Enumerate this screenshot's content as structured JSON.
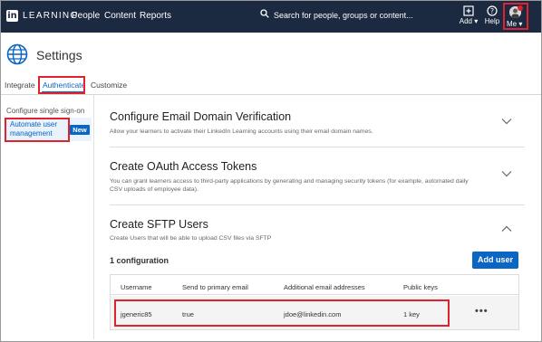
{
  "nav": {
    "logo": "in",
    "brand": "LEARNING",
    "links": [
      "People",
      "Content",
      "Reports"
    ],
    "search_placeholder": "Search for people, groups or content...",
    "add_label": "Add ▾",
    "help_label": "Help",
    "me_label": "Me ▾"
  },
  "page": {
    "title": "Settings"
  },
  "tabs": [
    "Integrate",
    "Authenticate",
    "Customize"
  ],
  "sidebar": {
    "section_title": "Configure single sign-on",
    "item_label": "Automate user management",
    "item_badge": "New"
  },
  "sections": [
    {
      "title": "Configure Email Domain Verification",
      "description": "Allow your learners to activate their LinkedIn Learning accounts using their email domain names."
    },
    {
      "title": "Create OAuth Access Tokens",
      "description": "You can grant learners access to third-party applications by generating and managing security tokens (for example, automated daily CSV uploads of employee data)."
    },
    {
      "title": "Create SFTP Users",
      "description": "Create Users that will be able to upload CSV files via SFTP"
    }
  ],
  "sftp": {
    "config_count": "1 configuration",
    "add_user_label": "Add user",
    "columns": [
      "Username",
      "Send to primary email",
      "Additional email addresses",
      "Public keys"
    ],
    "rows": [
      [
        "jgeneric85",
        "true",
        "jdoe@linkedin.com",
        "1 key"
      ]
    ],
    "more_label": "•••"
  },
  "colors": {
    "nav_bg": "#1b2a41",
    "accent": "#0a66c2",
    "highlight": "#e0222e"
  }
}
